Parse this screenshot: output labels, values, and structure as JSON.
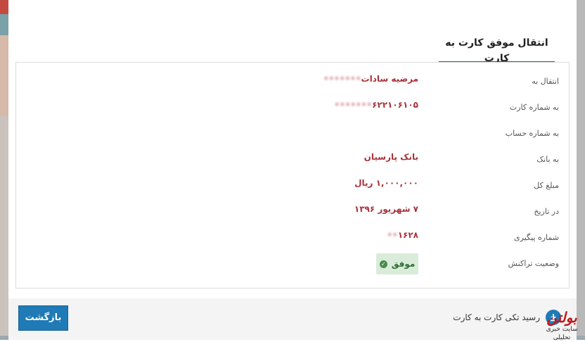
{
  "tab": {
    "label": "انتقال موفق کارت به کارت"
  },
  "details": [
    {
      "label": "انتقال به",
      "value": "مرضیه سادات",
      "masked": "•••••••"
    },
    {
      "label": "به شماره کارت",
      "value": "۶۲۲۱۰۶۱۰۵",
      "masked": "•••••••"
    },
    {
      "label": "به شماره حساب",
      "value": "",
      "masked": ""
    },
    {
      "label": "به بانک",
      "value": "بانک پارسیان",
      "masked": ""
    },
    {
      "label": "مبلغ کل",
      "value": "۱,۰۰۰,۰۰۰ ریال",
      "masked": ""
    },
    {
      "label": "در تاریخ",
      "value": "۷ شهریور ۱۳۹۶",
      "masked": ""
    },
    {
      "label": "شماره پیگیری",
      "value": "۱۶۲۸",
      "masked": "••"
    },
    {
      "label": "وضعیت تراکنش",
      "value": "موفق",
      "masked": ""
    }
  ],
  "footer": {
    "back_label": "بازگشت",
    "receipt_label": "رسید تکی کارت به کارت"
  },
  "watermark": {
    "logo": "بولتن",
    "subtitle": "سایت خبری تحلیلی"
  },
  "colors": {
    "accent": "#1f7ab6",
    "tab_underline": "#17851f",
    "value_text": "#a8323a",
    "success_bg": "#d9ecd9"
  }
}
